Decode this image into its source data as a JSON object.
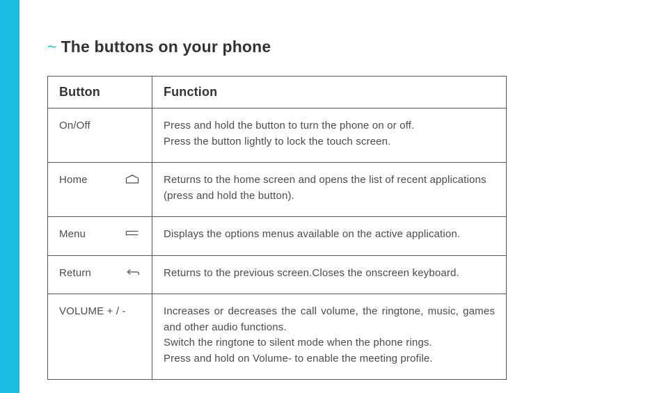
{
  "section": {
    "title_prefix": "~",
    "title": "The buttons on your phone"
  },
  "table": {
    "headers": {
      "button": "Button",
      "function": "Function"
    },
    "rows": [
      {
        "button": "On/Off",
        "icon": null,
        "function_lines": [
          "Press and hold the button to turn the phone on or off.",
          "Press the button lightly to lock the touch screen."
        ]
      },
      {
        "button": "Home",
        "icon": "home-outline-icon",
        "function_lines": [
          "Returns to the home screen and opens the list of recent applications (press and hold the button)."
        ]
      },
      {
        "button": "Menu",
        "icon": "menu-lines-icon",
        "function_lines": [
          "Displays the options menus available on the active application."
        ]
      },
      {
        "button": "Return",
        "icon": "return-arrow-icon",
        "function_lines": [
          "Returns to the previous screen.Closes the onscreen keyboard."
        ]
      },
      {
        "button": "VOLUME + / -",
        "icon": null,
        "function_lines": [
          "Increases or decreases the call volume, the ringtone, music, games and other audio functions.",
          "Switch the ringtone to silent mode when the phone rings.",
          "Press and hold on Volume- to enable the meeting profile."
        ]
      }
    ]
  }
}
